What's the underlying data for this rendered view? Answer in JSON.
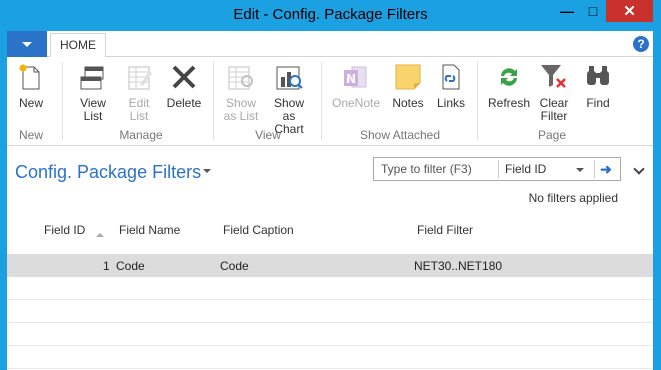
{
  "window": {
    "title": "Edit - Config. Package Filters"
  },
  "ribbon": {
    "tab": "HOME",
    "groups": [
      {
        "label": "New",
        "buttons": [
          {
            "label": "New",
            "icon": "new-icon",
            "enabled": true
          }
        ]
      },
      {
        "label": "Manage",
        "buttons": [
          {
            "label": "View List",
            "icon": "view-list-icon",
            "enabled": true
          },
          {
            "label": "Edit List",
            "icon": "edit-list-icon",
            "enabled": false
          },
          {
            "label": "Delete",
            "icon": "delete-icon",
            "enabled": true
          }
        ]
      },
      {
        "label": "View",
        "buttons": [
          {
            "label": "Show as List",
            "icon": "show-as-list-icon",
            "enabled": false
          },
          {
            "label": "Show as Chart",
            "icon": "show-as-chart-icon",
            "enabled": true
          }
        ]
      },
      {
        "label": "Show Attached",
        "buttons": [
          {
            "label": "OneNote",
            "icon": "onenote-icon",
            "enabled": false
          },
          {
            "label": "Notes",
            "icon": "notes-icon",
            "enabled": true
          },
          {
            "label": "Links",
            "icon": "links-icon",
            "enabled": true
          }
        ]
      },
      {
        "label": "Page",
        "buttons": [
          {
            "label": "Refresh",
            "icon": "refresh-icon",
            "enabled": true
          },
          {
            "label": "Clear Filter",
            "icon": "clear-filter-icon",
            "enabled": true
          },
          {
            "label": "Find",
            "icon": "find-icon",
            "enabled": true
          }
        ]
      }
    ]
  },
  "page": {
    "title": "Config. Package Filters",
    "filter": {
      "placeholder": "Type to filter (F3)",
      "field": "Field ID"
    },
    "status": "No filters applied"
  },
  "grid": {
    "columns": [
      "Field ID",
      "Field Name",
      "Field Caption",
      "Field Filter"
    ],
    "rows": [
      {
        "field_id": "1",
        "field_name": "Code",
        "field_caption": "Code",
        "field_filter": "NET30..NET180"
      }
    ]
  },
  "colors": {
    "titlebar": "#1ba1e2",
    "accent": "#2a73c8",
    "close": "#c7302b",
    "selected_row": "#dcdcdc"
  }
}
